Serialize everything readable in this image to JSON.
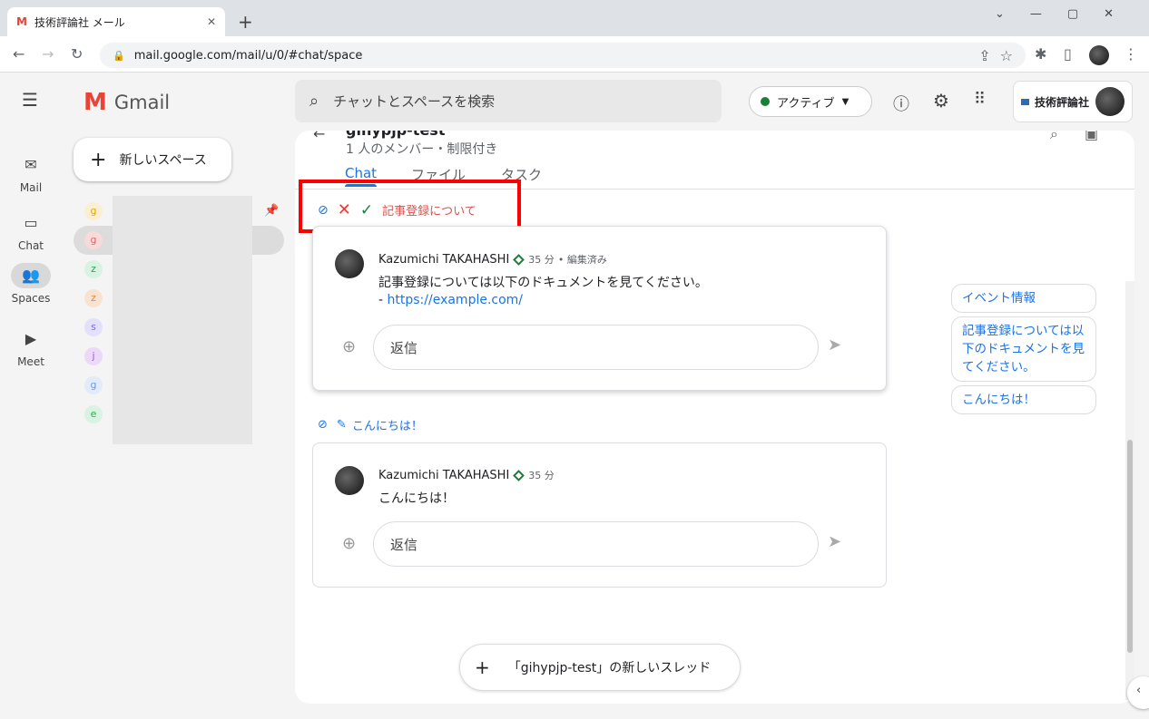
{
  "browser": {
    "tab_title": "技術評論社 メール",
    "url": "mail.google.com/mail/u/0/#chat/space"
  },
  "rail": [
    {
      "label": "Mail",
      "icon": "mail-icon"
    },
    {
      "label": "Chat",
      "icon": "chat-icon"
    },
    {
      "label": "Spaces",
      "icon": "spaces-icon"
    },
    {
      "label": "Meet",
      "icon": "meet-icon"
    }
  ],
  "brand": "Gmail",
  "new_space": "新しいスペース",
  "spaces": [
    {
      "initial": "g",
      "bg": "#fbefd2",
      "fg": "#e8a400"
    },
    {
      "initial": "g",
      "bg": "#f9dada",
      "fg": "#e06666"
    },
    {
      "initial": "z",
      "bg": "#d9f3e2",
      "fg": "#2e9e5b"
    },
    {
      "initial": "z",
      "bg": "#f8e2d2",
      "fg": "#e08a3c"
    },
    {
      "initial": "s",
      "bg": "#e3e0fb",
      "fg": "#7b6cf0"
    },
    {
      "initial": "j",
      "bg": "#ecd9f7",
      "fg": "#a05ad6"
    },
    {
      "initial": "g",
      "bg": "#e1ebfa",
      "fg": "#6d9be6"
    },
    {
      "initial": "e",
      "bg": "#d9f3e2",
      "fg": "#34a853"
    }
  ],
  "search_placeholder": "チャットとスペースを検索",
  "status": "アクティブ",
  "account_name": "技術評論社",
  "space": {
    "title": "gihypjp-test",
    "subtitle": "1 人のメンバー・制限付き",
    "tabs": [
      "Chat",
      "ファイル",
      "タスク"
    ]
  },
  "filter": {
    "topic": "記事登録について"
  },
  "messages": [
    {
      "author": "Kazumichi TAKAHASHI",
      "time": "35 分",
      "edited": "• 編集済み",
      "text": "記事登録については以下のドキュメントを見てください。",
      "link_prefix": "- ",
      "link": "https://example.com/",
      "reply": "返信"
    },
    {
      "topic": "こんにちは！",
      "author": "Kazumichi TAKAHASHI",
      "time": "35 分",
      "text": "こんにちは！",
      "reply": "返信"
    }
  ],
  "chips": [
    "イベント情報",
    "記事登録については以下のドキュメントを見てください。",
    "こんにちは！"
  ],
  "new_thread": "「gihypjp-test」の新しいスレッド",
  "colors": {
    "accent": "#1a73e8",
    "highlight_box": "#ff0000",
    "topic_red": "#d93025",
    "active": "#188038"
  }
}
